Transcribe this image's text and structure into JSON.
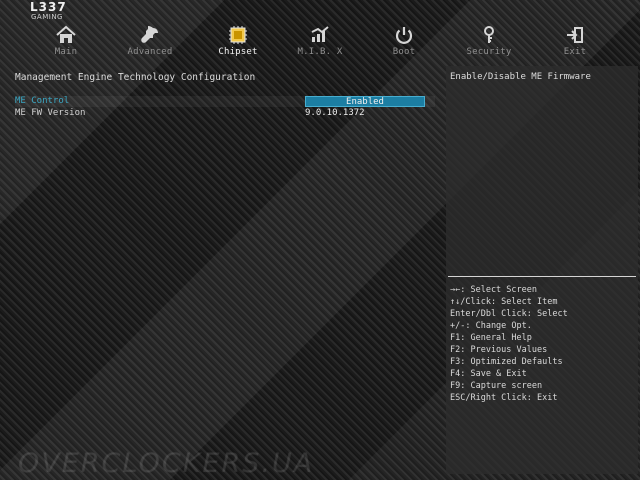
{
  "brand": {
    "mark": "L337",
    "subtitle": "GAMING"
  },
  "tabs": [
    {
      "label": "Main",
      "icon": "home-icon"
    },
    {
      "label": "Advanced",
      "icon": "wrench-icon"
    },
    {
      "label": "Chipset",
      "icon": "chip-icon"
    },
    {
      "label": "M.I.B. X",
      "icon": "chart-icon"
    },
    {
      "label": "Boot",
      "icon": "power-icon"
    },
    {
      "label": "Security",
      "icon": "key-icon"
    },
    {
      "label": "Exit",
      "icon": "exit-icon"
    }
  ],
  "active_tab": "Chipset",
  "left_panel": {
    "title": "Management Engine Technology Configuration",
    "rows": [
      {
        "label": "ME Control",
        "value": "Enabled"
      },
      {
        "label": "ME FW Version",
        "value": "9.0.10.1372"
      }
    ]
  },
  "right_panel": {
    "title": "Enable/Disable ME Firmware",
    "help": [
      "→←: Select Screen",
      "↑↓/Click: Select Item",
      "Enter/Dbl Click: Select",
      "+/-: Change Opt.",
      "F1: General Help",
      "F2: Previous Values",
      "F3: Optimized Defaults",
      "F4: Save & Exit",
      "F9: Capture screen",
      "ESC/Right Click: Exit"
    ]
  },
  "watermark": "OVERCLOCKERS.UA",
  "colors": {
    "accent": "#1c7ea3",
    "text": "#d8d8d8",
    "muted": "#8f8f8f"
  }
}
